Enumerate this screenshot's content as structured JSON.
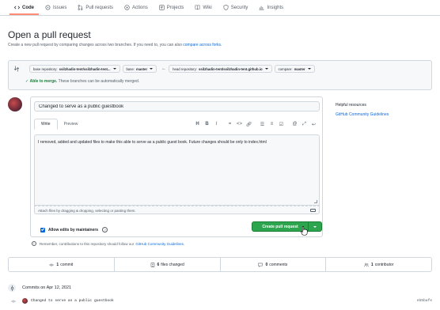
{
  "tabs": [
    {
      "label": "Code",
      "icon": "code-icon",
      "active": true
    },
    {
      "label": "Issues",
      "icon": "issue-icon"
    },
    {
      "label": "Pull requests",
      "icon": "pull-request-icon"
    },
    {
      "label": "Actions",
      "icon": "play-icon"
    },
    {
      "label": "Projects",
      "icon": "project-icon"
    },
    {
      "label": "Wiki",
      "icon": "book-icon"
    },
    {
      "label": "Security",
      "icon": "shield-icon"
    },
    {
      "label": "Insights",
      "icon": "graph-icon"
    }
  ],
  "header": {
    "title": "Open a pull request",
    "subtitle": "Create a new pull request by comparing changes across two branches. If you need to, you can also",
    "subtitle_link": "compare across forks."
  },
  "compare": {
    "base_repo_label": "base repository:",
    "base_repo_value": "ssilzhadin-tent/ssilzhadin-tent...",
    "base_label": "base:",
    "base_value": "master",
    "head_repo_label": "head repository:",
    "head_repo_value": "ssilzhadin-tent/ssilzhadin-tent.github.io",
    "compare_label": "compare:",
    "compare_value": "master",
    "merge_ok": "Able to merge.",
    "merge_msg": "These branches can be automatically merged."
  },
  "form": {
    "title_value": "Changed to serve as a public guestbook",
    "tab_write": "Write",
    "tab_preview": "Preview",
    "body_text": "I removed, added and updated files to make this able to serve as a public guest book. Future changes should be only to index.html",
    "attach_text": "Attach files by dragging & dropping, selecting or pasting them.",
    "allow_edits": "Allow edits by maintainers",
    "create_button": "Create pull request",
    "reminder": "Remember, contributions to this repository should follow our",
    "reminder_link": "GitHub Community Guidelines."
  },
  "sidebar": {
    "heading": "Helpful resources",
    "link": "GitHub Community Guidelines"
  },
  "stats": {
    "commits": "1",
    "commits_label": "commit",
    "files": "6",
    "files_label": "files changed",
    "comments": "0",
    "comments_label": "comments",
    "contributors": "1",
    "contributors_label": "contributor"
  },
  "commits": {
    "heading": "Commits on Apr 12, 2021",
    "items": [
      {
        "message": "Changed to serve as a public guestbook",
        "sha": "eb5bafe"
      }
    ]
  },
  "colors": {
    "primary_button": "#2da44e",
    "link": "#0969da",
    "success": "#1a7f37",
    "tab_underline": "#fd8c73"
  }
}
